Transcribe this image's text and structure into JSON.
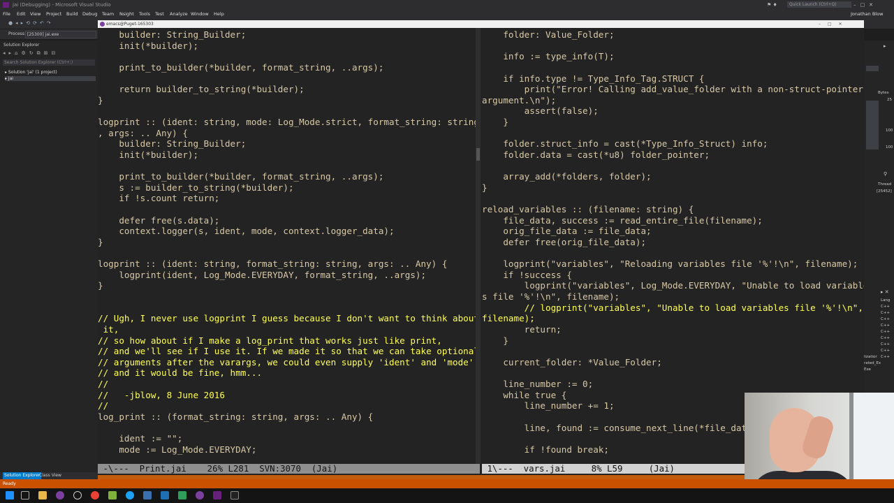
{
  "vs": {
    "title": "jai (Debugging) - Microsoft Visual Studio",
    "quick_launch_placeholder": "Quick Launch (Ctrl+Q)",
    "user_name": "Jonathan Blow",
    "menu": [
      "File",
      "Edit",
      "View",
      "Project",
      "Build",
      "Debug",
      "Team",
      "Nsight",
      "Tools",
      "Test",
      "Analyze",
      "Window",
      "Help"
    ],
    "process_label": "Process:",
    "process_value": "[25300] jai.exe",
    "solution_explorer": {
      "title": "Solution Explorer",
      "search_placeholder": "Search Solution Explorer (Ctrl+;)",
      "solution_node": "Solution 'jai' (1 project)",
      "project_node": "jai"
    },
    "bottom_tabs": [
      "Solution Explorer",
      "Class View"
    ],
    "status_text": "Ready",
    "right_panel": {
      "bytes_label": "Bytes",
      "values": [
        "25",
        "100",
        "100"
      ],
      "thread_label": "Thread",
      "thread_value": "[25452]",
      "lang_label": "Lang",
      "lang_items": [
        "C++",
        "C++",
        "C++",
        "C++",
        "C++",
        "C++",
        "C++",
        "C++",
        "C++"
      ],
      "partial_texts": [
        "lizatior",
        "rated_Ex",
        "Exe"
      ]
    }
  },
  "emacs": {
    "title": "emacs@Puget-165303",
    "left_pane": {
      "lines": [
        "    builder: String_Builder;",
        "    init(*builder);",
        "",
        "    print_to_builder(*builder, format_string, ..args);",
        "",
        "    return builder_to_string(*builder);",
        "}",
        "",
        "logprint :: (ident: string, mode: Log_Mode.strict, format_string: string",
        ", args: .. Any) {",
        "    builder: String_Builder;",
        "    init(*builder);",
        "",
        "    print_to_builder(*builder, format_string, ..args);",
        "    s := builder_to_string(*builder);",
        "    if !s.count return;",
        "",
        "    defer free(s.data);",
        "    context.logger(s, ident, mode, context.logger_data);",
        "}",
        "",
        "logprint :: (ident: string, format_string: string, args: .. Any) {",
        "    logprint(ident, Log_Mode.EVERYDAY, format_string, ..args);",
        "}",
        "",
        "",
        "// Ugh, I never use logprint I guess because I don't want to think about",
        " it,",
        "// so how about if I make a log_print that works just like print,",
        "// and we'll see if I use it. If we made it so that we can take optional",
        "// arguments after the varargs, we could even supply 'ident' and 'mode'",
        "// and it would be fine, hmm...",
        "//",
        "//   -jblow, 8 June 2016",
        "//",
        "log_print :: (format_string: string, args: .. Any) {",
        "",
        "    ident := \"\";",
        "    mode := Log_Mode.EVERYDAY;"
      ],
      "mode_line": " -\\---  Print.jai    26% L281  SVN:3070  (Jai)"
    },
    "right_pane": {
      "lines": [
        "    folder: Value_Folder;",
        "",
        "    info := type_info(T);",
        "",
        "    if info.type != Type_Info_Tag.STRUCT {",
        "        print(\"Error! Calling add_value_folder with a non-struct-pointer",
        "argument.\\n\");",
        "        assert(false);",
        "    }",
        "",
        "    folder.struct_info = cast(*Type_Info_Struct) info;",
        "    folder.data = cast(*u8) folder_pointer;",
        "",
        "    array_add(*folders, folder);",
        "}",
        "",
        "reload_variables :: (filename: string) {",
        "    file_data, success := read_entire_file(filename);",
        "    orig_file_data := file_data;",
        "    defer free(orig_file_data);",
        "",
        "    logprint(\"variables\", \"Reloading variables file '%'!\\n\", filename);",
        "    if !success {",
        "        logprint(\"variables\", Log_Mode.EVERYDAY, \"Unable to load variable",
        "s file '%'!\\n\", filename);",
        "        // logprint(\"variables\", \"Unable to load variables file '%'!\\n\",",
        "filename);",
        "        return;",
        "    }",
        "",
        "    current_folder: *Value_Folder;",
        "",
        "    line_number := 0;",
        "    while true {",
        "        line_number += 1;",
        "",
        "        line, found := consume_next_line(*file_data);",
        "",
        "        if !found break;"
      ],
      "mode_line": " 1\\---  vars.jai     8% L59     (Jai)"
    }
  }
}
